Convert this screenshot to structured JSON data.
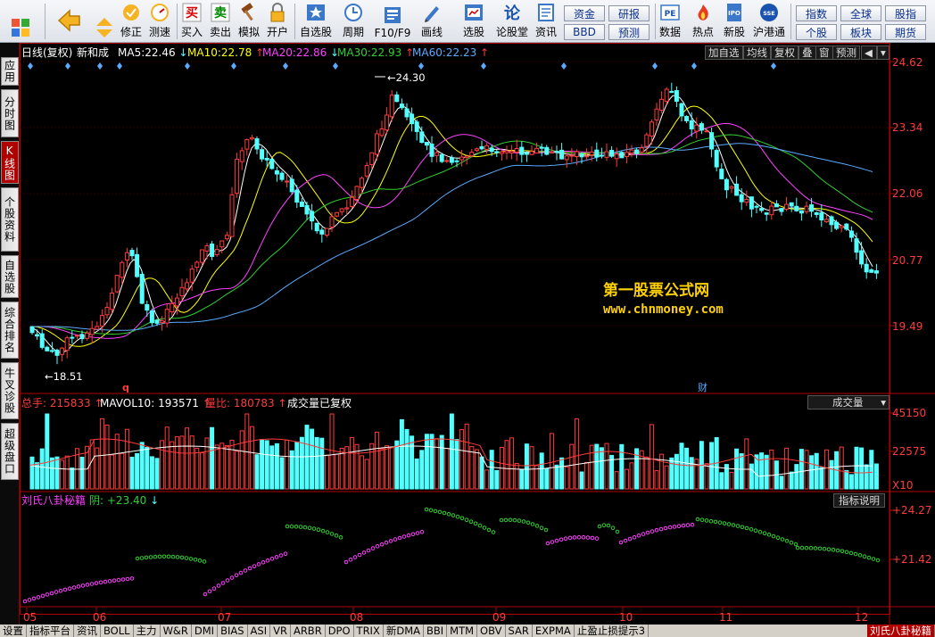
{
  "toolbar": {
    "buttons": [
      {
        "label": "",
        "icon": "grid-icon"
      },
      {
        "label": "",
        "icon": "back-arrow-icon"
      },
      {
        "label": "",
        "icon": "up-down-arrow-icon"
      },
      {
        "label": "修正",
        "icon": "fix-icon"
      },
      {
        "label": "测速",
        "icon": "speed-icon"
      },
      {
        "label": "买入",
        "icon": "buy-icon"
      },
      {
        "label": "卖出",
        "icon": "sell-icon"
      },
      {
        "label": "模拟",
        "icon": "hammer-icon"
      },
      {
        "label": "开户",
        "icon": "lock-icon"
      },
      {
        "label": "自选股",
        "icon": "star-icon"
      },
      {
        "label": "周期",
        "icon": "cycle-icon"
      },
      {
        "label": "F10/F9",
        "icon": "f10-icon"
      },
      {
        "label": "画线",
        "icon": "pen-icon"
      },
      {
        "label": "选股",
        "icon": "select-icon"
      },
      {
        "label": "论股堂",
        "icon": "forum-icon"
      },
      {
        "label": "资讯",
        "icon": "info-icon"
      },
      {
        "label": "数据",
        "icon": "pe-icon"
      },
      {
        "label": "热点",
        "icon": "hot-icon"
      },
      {
        "label": "新股",
        "icon": "ipo-icon"
      },
      {
        "label": "沪港通",
        "icon": "hk-icon"
      }
    ],
    "small_buttons": [
      "资金",
      "研报",
      "BBD",
      "预测",
      "指数",
      "全球",
      "股指",
      "个股",
      "板块",
      "期货"
    ]
  },
  "sidebar": {
    "tabs": [
      "应用",
      "分时图",
      "K线图",
      "个股资料",
      "自选股",
      "综合排名",
      "牛叉诊股",
      "超级盘口"
    ],
    "active": 2
  },
  "main": {
    "period": "日线(复权)",
    "stock": "新和成",
    "ma": [
      {
        "label": "MA5:",
        "value": "22.46",
        "dir": "down",
        "color": "#ffffff"
      },
      {
        "label": "MA10:",
        "value": "22.78",
        "dir": "up",
        "color": "#ffff00"
      },
      {
        "label": "MA20:",
        "value": "22.86",
        "dir": "down",
        "color": "#ff40ff"
      },
      {
        "label": "MA30:",
        "value": "22.93",
        "dir": "up",
        "color": "#30d030"
      },
      {
        "label": "MA60:",
        "value": "22.23",
        "dir": "up",
        "color": "#5aaaff"
      }
    ],
    "right_buttons": [
      "加自选",
      "均线",
      "复权",
      "叠",
      "窗",
      "预测"
    ],
    "price_axis": [
      "24.62",
      "23.34",
      "22.06",
      "20.77",
      "19.49"
    ],
    "high_label": "24.30",
    "low_label": "18.51",
    "marker_q": "q",
    "marker_cai": "财",
    "watermark_1": "第一股票公式网",
    "watermark_2": "www.chnmoney.com"
  },
  "volume": {
    "total_label": "总手:",
    "total_value": "215833",
    "mavol_label": "MAVOL10:",
    "mavol_value": "193571",
    "ratio_label": "量比:",
    "ratio_value": "180783",
    "note": "成交量已复权",
    "dropdown": "成交量",
    "axis": [
      "45150",
      "22575"
    ],
    "unit": "X10"
  },
  "indicator": {
    "name": "刘氏八卦秘籍",
    "state_label": "阴:",
    "state_value": "+23.40",
    "explain": "指标说明",
    "axis": [
      "+24.27",
      "+21.42"
    ]
  },
  "months": [
    "05",
    "06",
    "07",
    "08",
    "09",
    "10",
    "11",
    "12"
  ],
  "bottom_tabs": [
    "设置",
    "指标平台",
    "资讯",
    "BOLL",
    "主力",
    "W&R",
    "DMI",
    "BIAS",
    "ASI",
    "VR",
    "ARBR",
    "DPO",
    "TRIX",
    "新DMA",
    "BBI",
    "MTM",
    "OBV",
    "SAR",
    "EXPMA",
    "止盈止损提示3",
    "刘氏八卦秘籍"
  ],
  "bottom_active": 20,
  "colors": {
    "up": "#ff3b3b",
    "down": "#54ffff",
    "grid": "#7a0000",
    "axis": "#b00000"
  }
}
